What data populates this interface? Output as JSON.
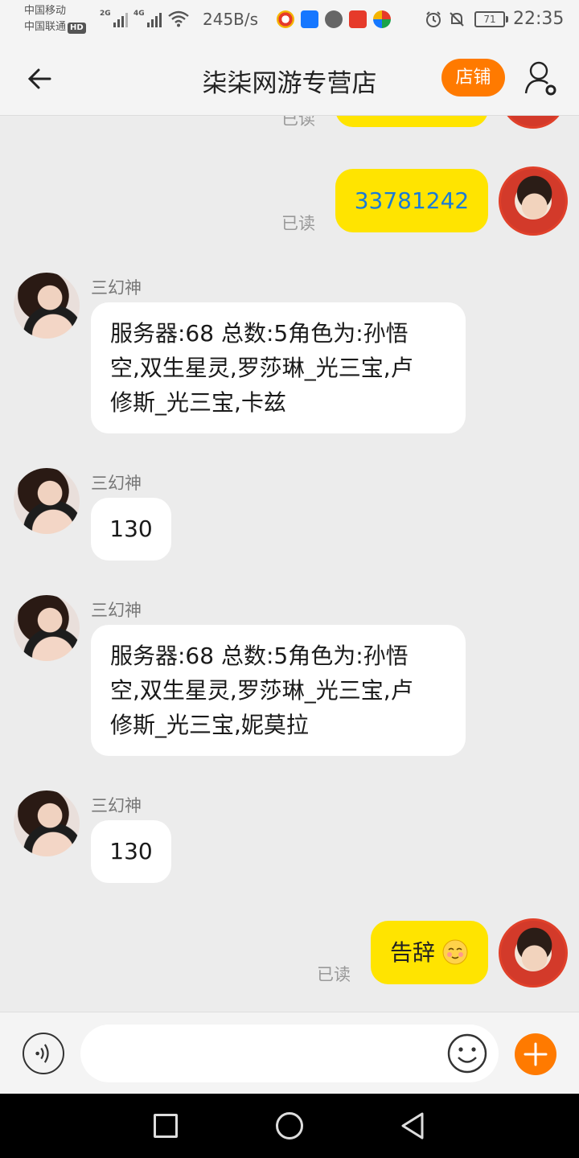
{
  "status_bar": {
    "carrier_1": "中国移动",
    "carrier_2": "中国联通",
    "hd_badge": "HD",
    "signal_1_label": "2G",
    "signal_2_label": "4G",
    "net_speed": "245B/s",
    "battery": "71",
    "time": "22:35",
    "app_icons": [
      "weibo-icon",
      "alipay-icon",
      "shield-app-icon",
      "500-app-icon",
      "lottery-app-icon"
    ]
  },
  "header": {
    "title": "柒柒网游专营店",
    "shop_button": "店铺"
  },
  "messages": [
    {
      "direction": "out",
      "text": "",
      "read": "已读",
      "partial": true
    },
    {
      "direction": "out",
      "text": "33781242",
      "read": "已读"
    },
    {
      "direction": "in",
      "sender": "三幻神",
      "lines": [
        "服务器:68 总数:5角色为:孙悟",
        "空,双生星灵,罗莎琳_光三宝,卢",
        "修斯_光三宝,卡兹"
      ]
    },
    {
      "direction": "in",
      "sender": "三幻神",
      "lines": [
        "130"
      ]
    },
    {
      "direction": "in",
      "sender": "三幻神",
      "lines": [
        "服务器:68 总数:5角色为:孙悟",
        "空,双生星灵,罗莎琳_光三宝,卢",
        "修斯_光三宝,妮莫拉"
      ]
    },
    {
      "direction": "in",
      "sender": "三幻神",
      "lines": [
        "130"
      ]
    },
    {
      "direction": "out",
      "text": "告辞",
      "read": "已读",
      "emoji": "blush-emoji"
    }
  ],
  "input_bar": {
    "placeholder": "",
    "voice_icon": "voice-icon",
    "emoji_icon": "smiley-icon",
    "plus_icon": "plus-icon"
  },
  "colors": {
    "accent_orange": "#ff7a00",
    "bubble_out": "#ffe400",
    "bubble_in": "#ffffff",
    "link_blue": "#1a7bd6"
  }
}
